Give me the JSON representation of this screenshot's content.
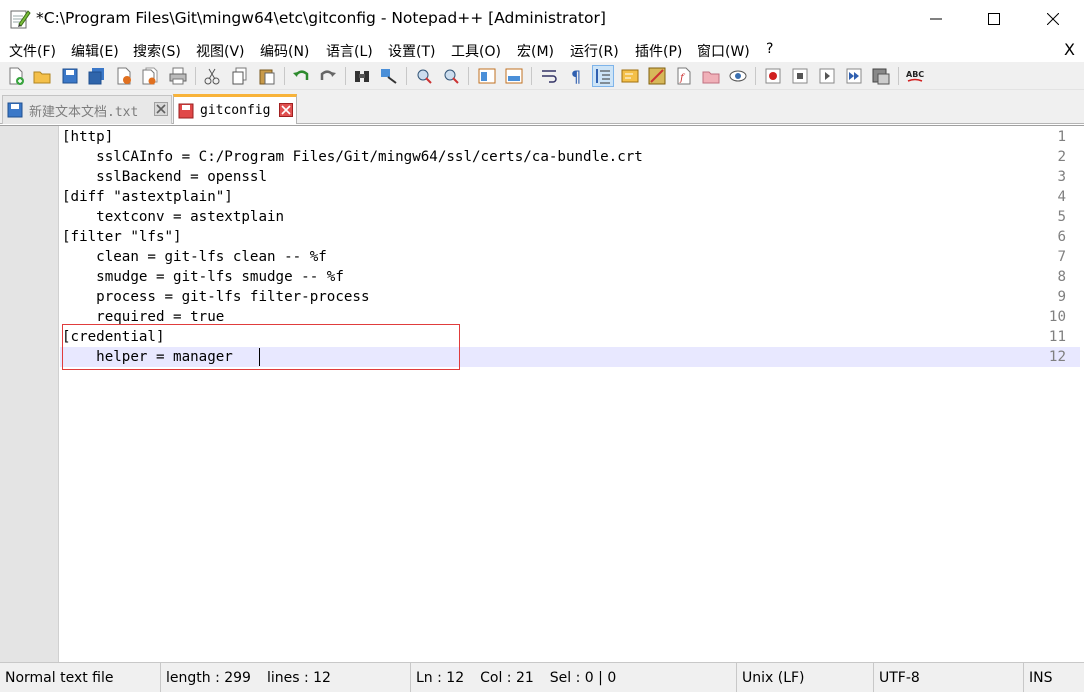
{
  "window": {
    "title": "*C:\\Program Files\\Git\\mingw64\\etc\\gitconfig - Notepad++ [Administrator]"
  },
  "menu": {
    "items": [
      "文件(F)",
      "编辑(E)",
      "搜索(S)",
      "视图(V)",
      "编码(N)",
      "语言(L)",
      "设置(T)",
      "工具(O)",
      "宏(M)",
      "运行(R)",
      "插件(P)",
      "窗口(W)",
      "?"
    ],
    "close": "X"
  },
  "tabs": [
    {
      "label": "新建文本文档.txt",
      "active": false
    },
    {
      "label": "gitconfig",
      "active": true
    }
  ],
  "editor": {
    "line_numbers": [
      "1",
      "2",
      "3",
      "4",
      "5",
      "6",
      "7",
      "8",
      "9",
      "10",
      "11",
      "12"
    ],
    "lines": [
      "[http]",
      "    sslCAInfo = C:/Program Files/Git/mingw64/ssl/certs/ca-bundle.crt",
      "    sslBackend = openssl",
      "[diff \"astextplain\"]",
      "    textconv = astextplain",
      "[filter \"lfs\"]",
      "    clean = git-lfs clean -- %f",
      "    smudge = git-lfs smudge -- %f",
      "    process = git-lfs filter-process",
      "    required = true",
      "[credential]",
      "    helper = manager"
    ]
  },
  "status": {
    "file_type": "Normal text file",
    "length": "length : 299",
    "lines": "lines : 12",
    "ln": "Ln : 12",
    "col": "Col : 21",
    "sel": "Sel : 0 | 0",
    "eol": "Unix (LF)",
    "encoding": "UTF-8",
    "mode": "INS"
  },
  "colors": {
    "accent_tab": "#f8b33a",
    "current_line": "#e8e8ff",
    "highlight_box": "#e03c3c"
  }
}
